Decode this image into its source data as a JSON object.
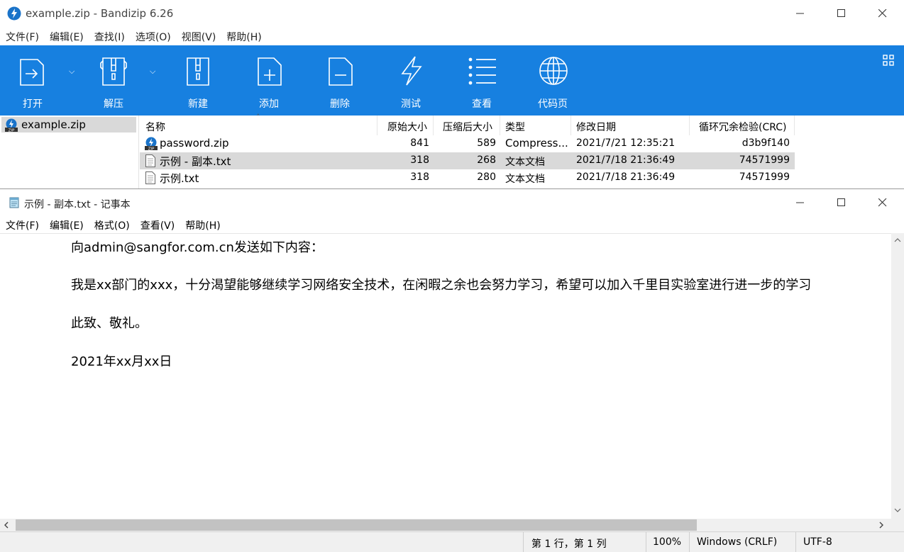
{
  "bandizip": {
    "title": "example.zip - Bandizip 6.26",
    "menu": [
      "文件(F)",
      "编辑(E)",
      "查找(I)",
      "选项(O)",
      "视图(V)",
      "帮助(H)"
    ],
    "toolbar": {
      "open": "打开",
      "extract": "解压",
      "new": "新建",
      "add": "添加",
      "delete": "删除",
      "test": "测试",
      "view": "查看",
      "codepage": "代码页"
    },
    "tree_root": "example.zip",
    "columns": {
      "name": "名称",
      "original_size": "原始大小",
      "compressed_size": "压缩后大小",
      "type": "类型",
      "modified": "修改日期",
      "crc": "循环冗余检验(CRC)"
    },
    "files": [
      {
        "name": "password.zip",
        "original_size": "841",
        "compressed_size": "589",
        "type": "Compress...",
        "modified": "2021/7/21 12:35:21",
        "crc": "d3b9f140"
      },
      {
        "name": "示例 - 副本.txt",
        "original_size": "318",
        "compressed_size": "268",
        "type": "文本文档",
        "modified": "2021/7/18 21:36:49",
        "crc": "74571999"
      },
      {
        "name": "示例.txt",
        "original_size": "318",
        "compressed_size": "280",
        "type": "文本文档",
        "modified": "2021/7/18 21:36:49",
        "crc": "74571999"
      }
    ],
    "selected_row": 1
  },
  "notepad": {
    "title": "示例 - 副本.txt - 记事本",
    "menu": [
      "文件(F)",
      "编辑(E)",
      "格式(O)",
      "查看(V)",
      "帮助(H)"
    ],
    "lines": [
      "向admin@sangfor.com.cn发送如下内容：",
      "我是xx部门的xxx，十分渴望能够继续学习网络安全技术，在闲暇之余也会努力学习，希望可以加入千里目实验室进行进一步的学习",
      "此致、敬礼。",
      "2021年xx月xx日"
    ],
    "status": {
      "position": "第 1 行，第 1 列",
      "zoom": "100%",
      "line_ending": "Windows (CRLF)",
      "encoding": "UTF-8"
    }
  },
  "colors": {
    "toolbar_bg": "#1780e0",
    "selection_bg": "#d9d9d9",
    "statusbar_bg": "#f0f0f0"
  }
}
